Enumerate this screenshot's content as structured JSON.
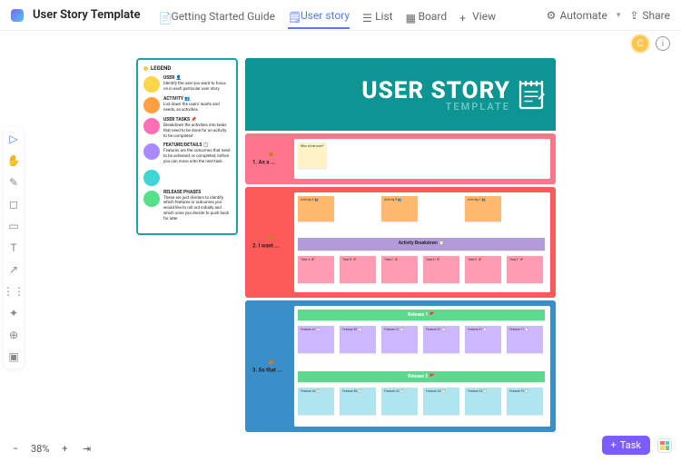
{
  "header": {
    "title": "User Story Template",
    "tabs": [
      {
        "label": "Getting Started Guide",
        "icon": "doc-icon"
      },
      {
        "label": "User story",
        "icon": "whiteboard-icon",
        "active": true
      },
      {
        "label": "List",
        "icon": "list-icon"
      },
      {
        "label": "Board",
        "icon": "board-icon"
      },
      {
        "label": "View",
        "icon": "plus-icon"
      }
    ],
    "automate": "Automate",
    "share": "Share"
  },
  "subhead": {
    "avatar_letter": "C"
  },
  "zoom": {
    "level": "38%"
  },
  "taskbtn": "Task",
  "board_header": {
    "title": "USER STORY",
    "subtitle": "TEMPLATE"
  },
  "legend": {
    "heading": "LEGEND",
    "items": [
      {
        "color": "#ffd54a",
        "title": "USER 👤",
        "desc": "Identify the user you want to focus on in each particular user story"
      },
      {
        "color": "#ff9f43",
        "title": "ACTIVITY 👥",
        "desc": "List down the users' wants and needs, as activities"
      },
      {
        "color": "#ff6fb5",
        "title": "USER TASKS 📌",
        "desc": "Breakdown the activities into tasks that need to be done for an activity to be completed"
      },
      {
        "color": "#a98bff",
        "title": "FEATURE/DETAILS 📋",
        "desc": "Features are the outcomes that need to be achieved, or completed, before you can move onto the next task."
      },
      {
        "color": "#40d6d6",
        "title": "",
        "desc": ""
      },
      {
        "color": "#57e08b",
        "title": "RELEASE PHASES",
        "desc": "These are just dividers to identify which features or outcomes you would like to roll out initially and which ones you decide to push back for later"
      }
    ]
  },
  "sections": {
    "s1": {
      "label": "1.  As a ...",
      "sticky": "Who is the user?"
    },
    "s2": {
      "label": "2.  I want ...",
      "activities": [
        "Activity A 👥",
        "Activity B 👥",
        "Activity C 👥"
      ],
      "breakdown": "Activity Breakdown 📋",
      "tasks": [
        "Task A 📌",
        "Task B 📌",
        "Task C 📌",
        "Task D 📌",
        "Task E 📌",
        "Task F 📌"
      ]
    },
    "s3": {
      "label": "3.  So that ...",
      "releases": [
        {
          "title": "Release 1 🚩",
          "features": [
            "Feature A1 📋",
            "Feature B1 📋",
            "Feature C1 📋",
            "Feature D1 📋",
            "Feature E1 📋",
            "Feature F1 📋"
          ]
        },
        {
          "title": "Release 2 🚩",
          "features": [
            "Feature A2 📋",
            "Feature B2 📋",
            "Feature C2 📋",
            "Feature D2 📋",
            "Feature E2 📋",
            "Feature F2 📋"
          ]
        }
      ]
    }
  }
}
